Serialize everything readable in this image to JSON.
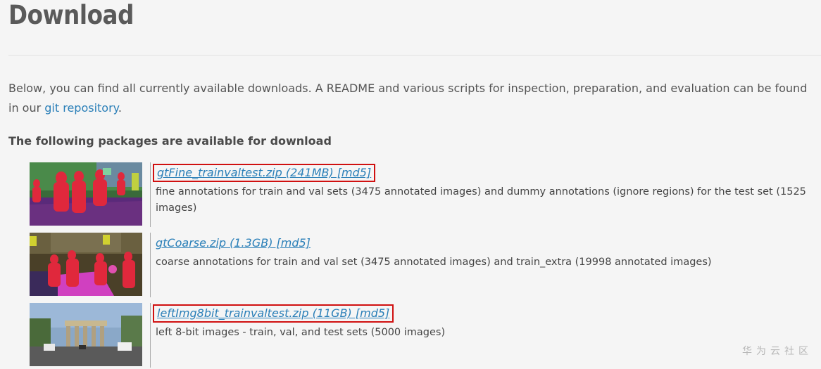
{
  "page": {
    "title": "Download",
    "intro_text": "Below, you can find all currently available downloads. A README and various scripts for inspection, preparation, and evaluation can be found in our ",
    "intro_link": "git repository",
    "intro_end": ".",
    "subheading": "The following packages are available for download"
  },
  "packages": [
    {
      "link": "gtFine_trainvaltest.zip (241MB) [md5]",
      "desc": "fine annotations for train and val sets (3475 annotated images) and dummy annotations (ignore regions) for the test set (1525 images)"
    },
    {
      "link": "gtCoarse.zip (1.3GB) [md5]",
      "desc": "coarse annotations for train and val set (3475 annotated images) and train_extra (19998 annotated images)"
    },
    {
      "link": "leftImg8bit_trainvaltest.zip (11GB) [md5]",
      "desc": "left 8-bit images - train, val, and test sets (5000 images)"
    }
  ],
  "watermark": "华为云社区",
  "colors": {
    "link": "#2a7fb8",
    "highlight_box": "#d01010",
    "background": "#f5f5f5"
  }
}
